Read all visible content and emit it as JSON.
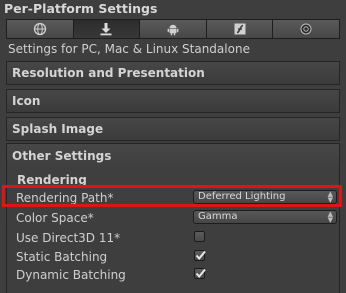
{
  "window": {
    "title": "Per-Platform Settings"
  },
  "tabs": [
    {
      "icon": "globe-icon",
      "active": false
    },
    {
      "icon": "download-icon",
      "active": true
    },
    {
      "icon": "android-icon",
      "active": false
    },
    {
      "icon": "flash-icon",
      "active": false
    },
    {
      "icon": "blackberry-icon",
      "active": false
    }
  ],
  "platform_caption": "Settings for PC, Mac & Linux Standalone",
  "sections": {
    "resolution": "Resolution and Presentation",
    "icon": "Icon",
    "splash": "Splash Image",
    "other": "Other Settings"
  },
  "rendering": {
    "heading": "Rendering",
    "rendering_path": {
      "label": "Rendering Path*",
      "value": "Deferred Lighting"
    },
    "color_space": {
      "label": "Color Space*",
      "value": "Gamma"
    },
    "use_direct3d11": {
      "label": "Use Direct3D 11*",
      "checked": false
    },
    "static_batching": {
      "label": "Static Batching",
      "checked": true
    },
    "dynamic_batching": {
      "label": "Dynamic Batching",
      "checked": true
    }
  },
  "colors": {
    "highlight": "#e01414",
    "background": "#3e3e3e"
  }
}
